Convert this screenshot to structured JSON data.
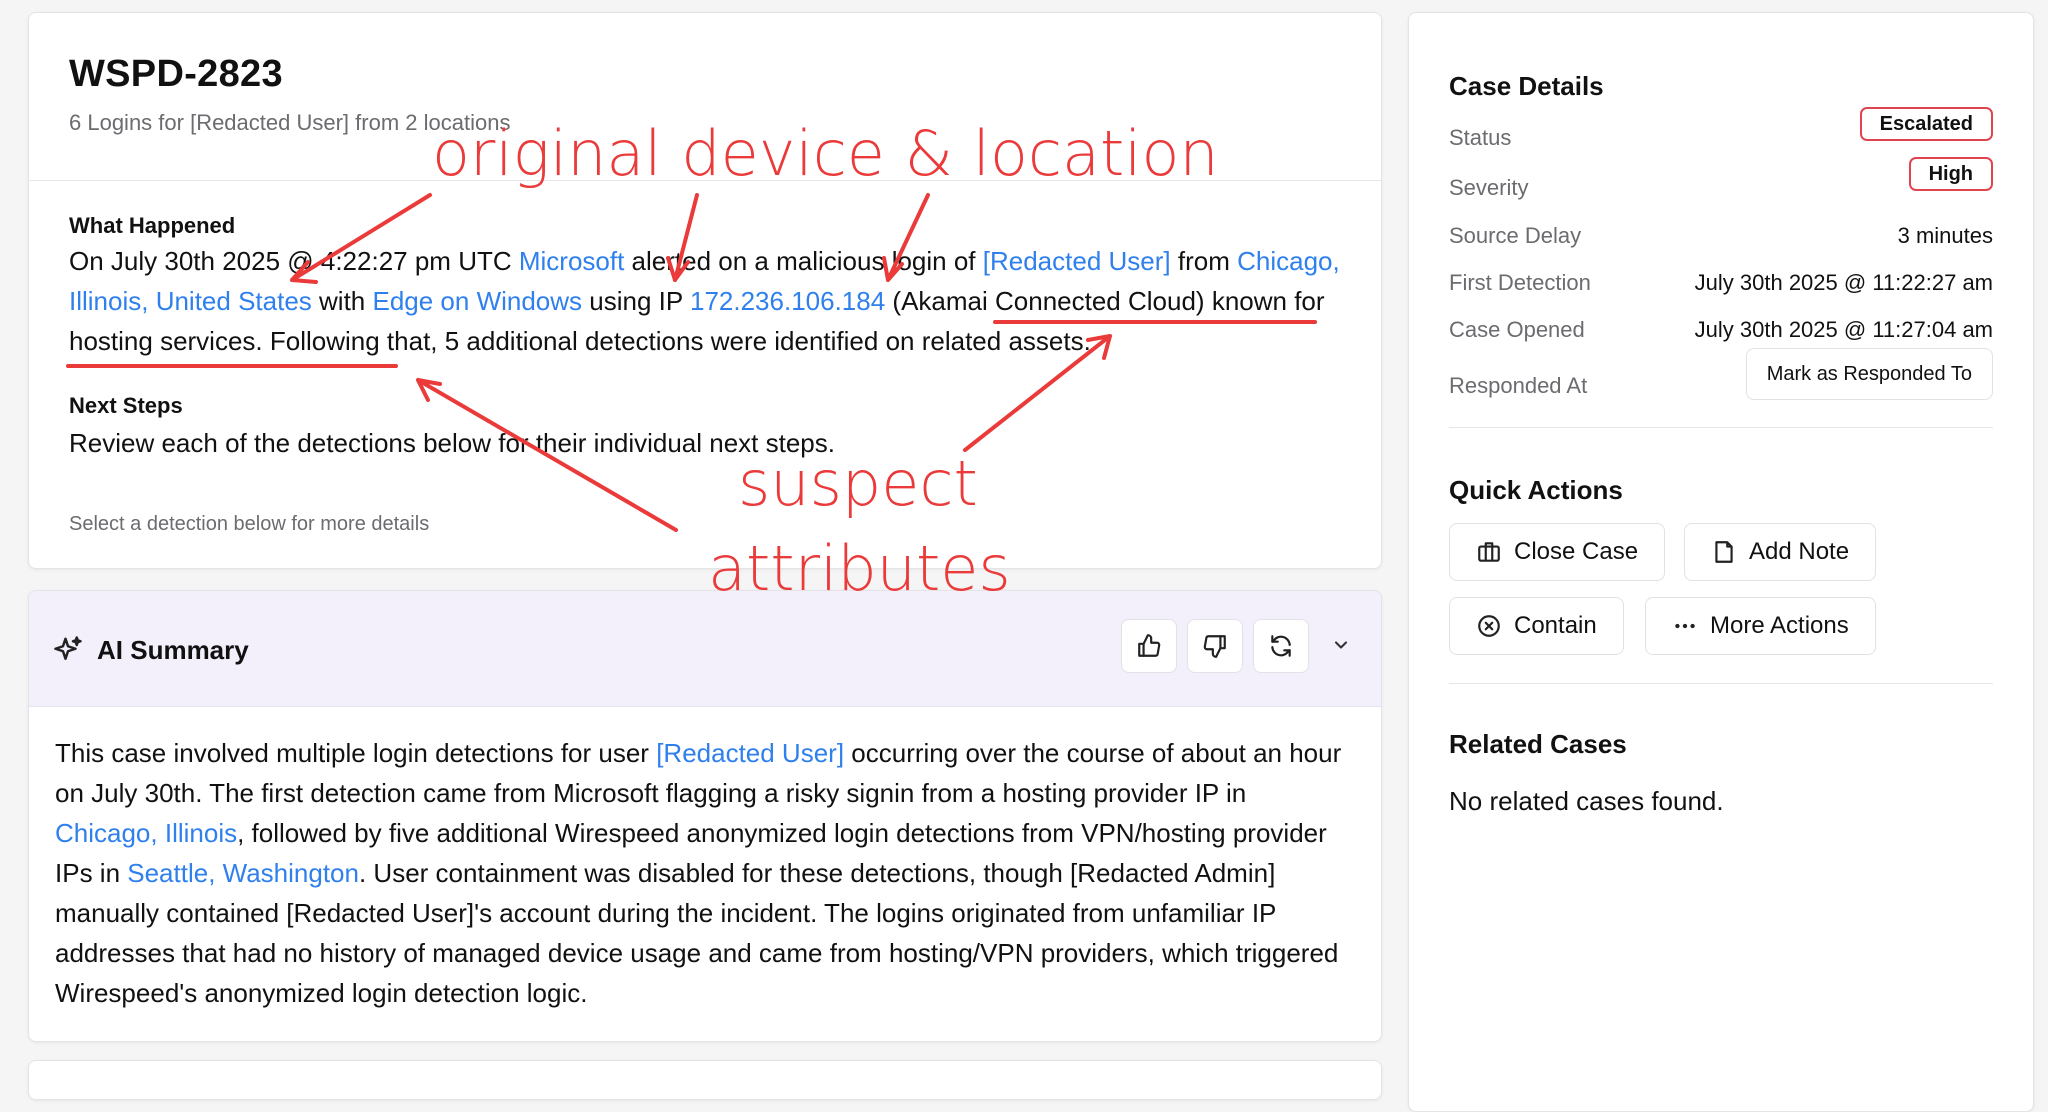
{
  "case": {
    "id": "WSPD-2823",
    "subtitle": "6 Logins for [Redacted User] from 2 locations",
    "what_happened_heading": "What Happened",
    "what_happened": {
      "t1": "On July 30th 2025 @ 4:22:27 pm UTC ",
      "vendor": "Microsoft",
      "t2": " alerted on a malicious login of ",
      "user": "[Redacted User]",
      "t3": " from ",
      "location": "Chicago, Illinois, United States",
      "t4": " with ",
      "device": "Edge on Windows",
      "t5": " using IP ",
      "ip": "172.236.106.184",
      "t6": " ",
      "provider": "(Akamai Connected Cloud)",
      "t7": " ",
      "hosting": "known for hosting services",
      "t8": ". Following that, 5 additional detections were identified on related assets."
    },
    "next_steps_heading": "Next Steps",
    "next_steps": "Review each of the detections below for their individual next steps.",
    "select_hint": "Select a detection below for more details"
  },
  "ai_summary": {
    "title": "AI Summary",
    "t1": "This case involved multiple login detections for user ",
    "user": "[Redacted User]",
    "t2": " occurring over the course of about an hour on July 30th. The first detection came from Microsoft flagging a risky signin from a hosting provider IP in ",
    "loc1": "Chicago, Illinois",
    "t3": ", followed by five additional Wirespeed anonymized login detections from VPN/hosting provider IPs in ",
    "loc2": "Seattle, Washington",
    "t4": ". User containment was disabled for these detections, though [Redacted Admin] manually contained [Redacted User]'s account during the incident. The logins originated from unfamiliar IP addresses that had no history of managed device usage and came from hosting/VPN providers, which triggered Wirespeed's anonymized login detection logic."
  },
  "case_details": {
    "heading": "Case Details",
    "status_label": "Status",
    "status_value": "Escalated",
    "severity_label": "Severity",
    "severity_value": "High",
    "source_delay_label": "Source Delay",
    "source_delay_value": "3 minutes",
    "first_detection_label": "First Detection",
    "first_detection_value": "July 30th 2025 @ 11:22:27 am",
    "case_opened_label": "Case Opened",
    "case_opened_value": "July 30th 2025 @ 11:27:04 am",
    "responded_label": "Responded At",
    "responded_button": "Mark as Responded To"
  },
  "quick_actions": {
    "heading": "Quick Actions",
    "close_case": "Close Case",
    "add_note": "Add Note",
    "contain": "Contain",
    "more_actions": "More Actions"
  },
  "related_cases": {
    "heading": "Related Cases",
    "empty": "No related cases found."
  },
  "annotations": {
    "top": "original device & location",
    "bottom_line1": "suspect",
    "bottom_line2": "attributes"
  },
  "colors": {
    "link": "#2f80ed",
    "annotation": "#ea3a3a",
    "badge_border": "#e0454f",
    "ai_header_bg": "#f3effb"
  }
}
